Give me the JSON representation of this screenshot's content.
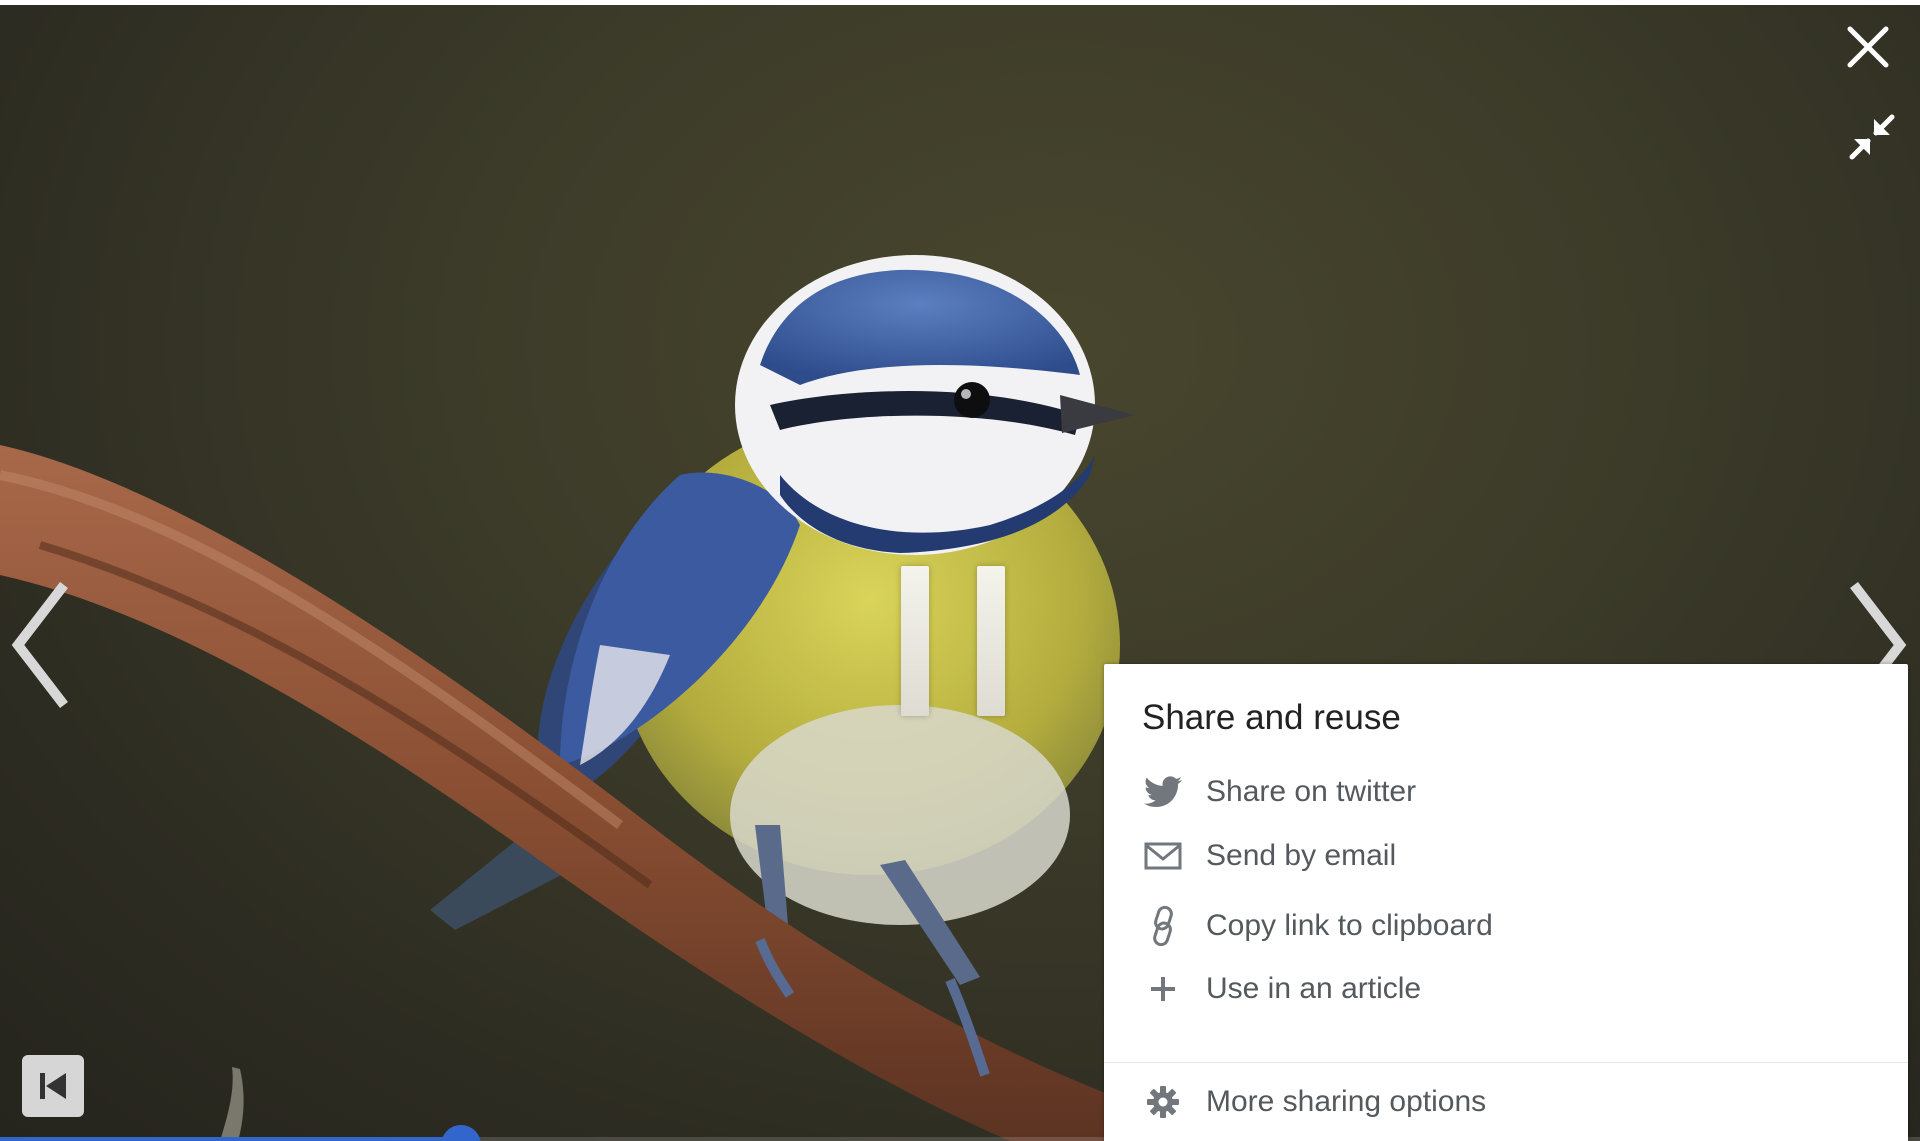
{
  "viewer": {
    "progress_fraction": 0.24,
    "icons": {
      "close": "close-icon",
      "collapse": "collapse-icon",
      "prev": "chevron-left-icon",
      "next": "chevron-right-icon",
      "pause": "pause-icon",
      "first": "skip-to-first-icon"
    }
  },
  "share": {
    "title": "Share and reuse",
    "items": [
      {
        "label": "Share on twitter",
        "icon": "twitter-icon"
      },
      {
        "label": "Send by email",
        "icon": "email-icon"
      },
      {
        "label": "Copy link to clipboard",
        "icon": "link-icon"
      },
      {
        "label": "Use in an article",
        "icon": "plus-icon"
      }
    ],
    "more": {
      "label": "More sharing options",
      "icon": "gear-icon"
    }
  },
  "colors": {
    "accent": "#3366cc",
    "panel_text": "#54595d",
    "panel_title": "#222222",
    "icon_gray": "#72777d"
  }
}
